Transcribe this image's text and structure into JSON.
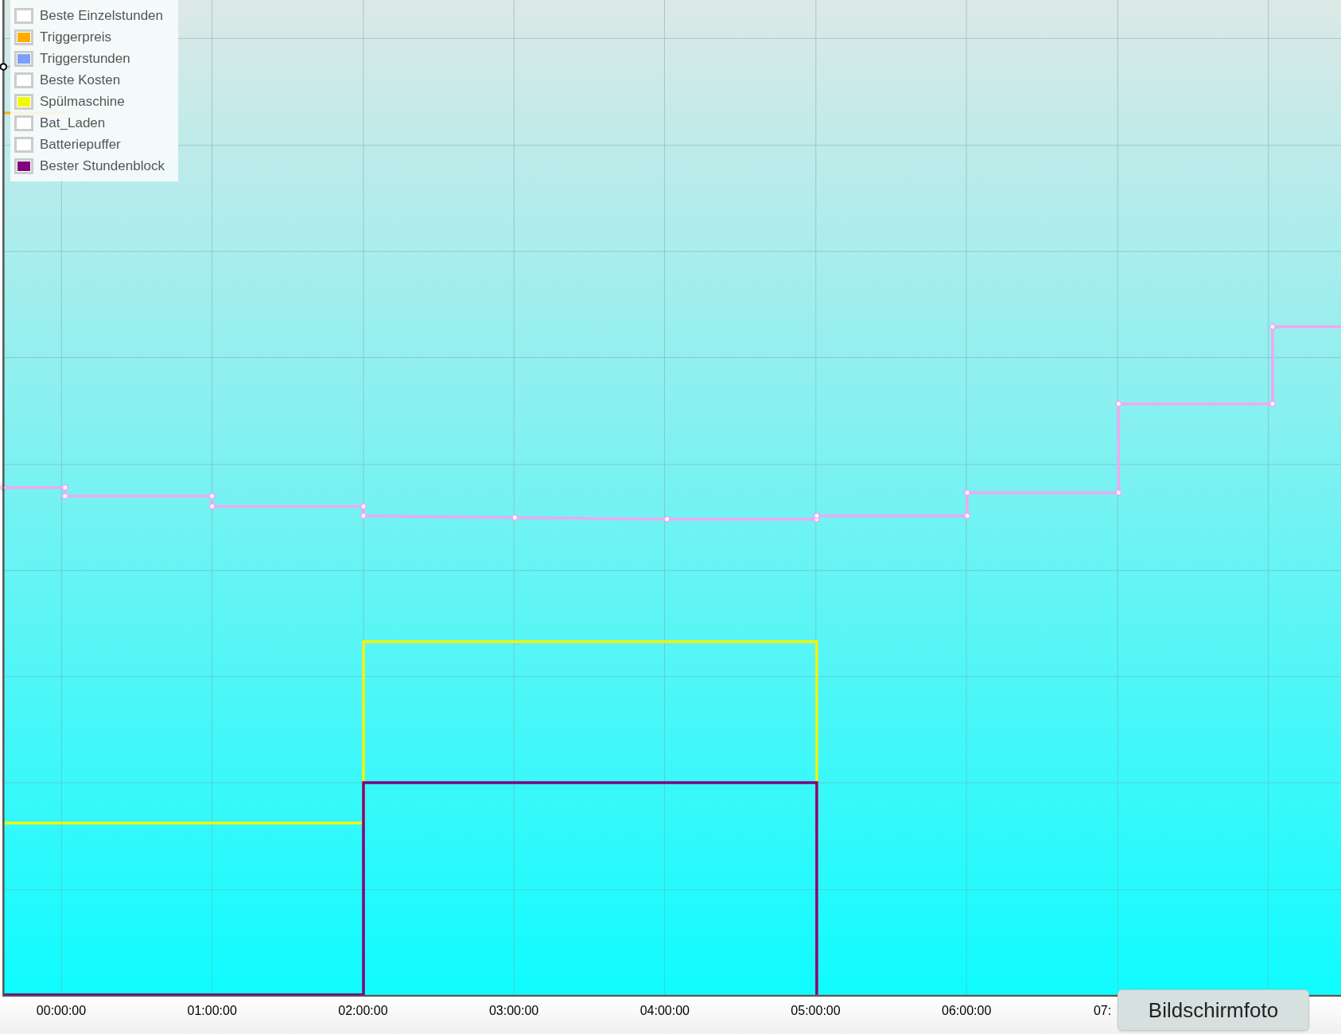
{
  "legend": [
    {
      "label": "Beste Einzelstunden",
      "color": "#ffffff"
    },
    {
      "label": "Triggerpreis",
      "color": "#ffad00"
    },
    {
      "label": "Triggerstunden",
      "color": "#7e9dfb"
    },
    {
      "label": "Beste Kosten",
      "color": "#ffffff"
    },
    {
      "label": "Spülmaschine",
      "color": "#f0f90a"
    },
    {
      "label": "Bat_Laden",
      "color": "#ffffff"
    },
    {
      "label": "Batteriepuffer",
      "color": "#ffffff"
    },
    {
      "label": "Bester Stundenblock",
      "color": "#800080"
    }
  ],
  "x_axis": {
    "ticks": [
      "00:00:00",
      "01:00:00",
      "02:00:00",
      "03:00:00",
      "04:00:00",
      "05:00:00",
      "06:00:00",
      "07:"
    ]
  },
  "tooltip": "Bildschirmfoto"
}
